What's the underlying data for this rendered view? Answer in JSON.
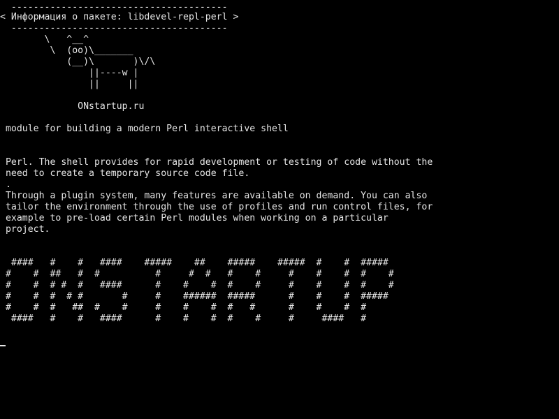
{
  "speech_bubble": {
    "border_top": "  ---------------------------------------",
    "message": "< Информация о пакете: libdevel-repl-perl >",
    "border_bottom": "  ---------------------------------------"
  },
  "cow_art": "        \\   ^__^\n         \\  (oo)\\_______\n            (__)\\       )\\/\\\n                ||----w |\n                ||     ||",
  "site_name": "              ONstartup.ru",
  "summary": " module for building a modern Perl interactive shell",
  "description_1": " Perl. The shell provides for rapid development or testing of code without the\n need to create a temporary source code file.\n .",
  "description_2": " Through a plugin system, many features are available on demand. You can also\n tailor the environment through the use of profiles and run control files, for\n example to pre-load certain Perl modules when working on a particular\n project.",
  "banner_art": "  ####   #    #   ####    #####    ##    #####    #####  #    #  #####\n #    #  ##   #  #          #     #  #   #    #     #    #    #  #    #\n #    #  # #  #   ####      #    #    #  #    #     #    #    #  #    #\n #    #  #  # #       #     #    ######  #####      #    #    #  #####\n #    #  #   ##  #    #     #    #    #  #   #      #    #    #  #\n  ####   #    #   ####      #    #    #  #    #     #     ####   #"
}
